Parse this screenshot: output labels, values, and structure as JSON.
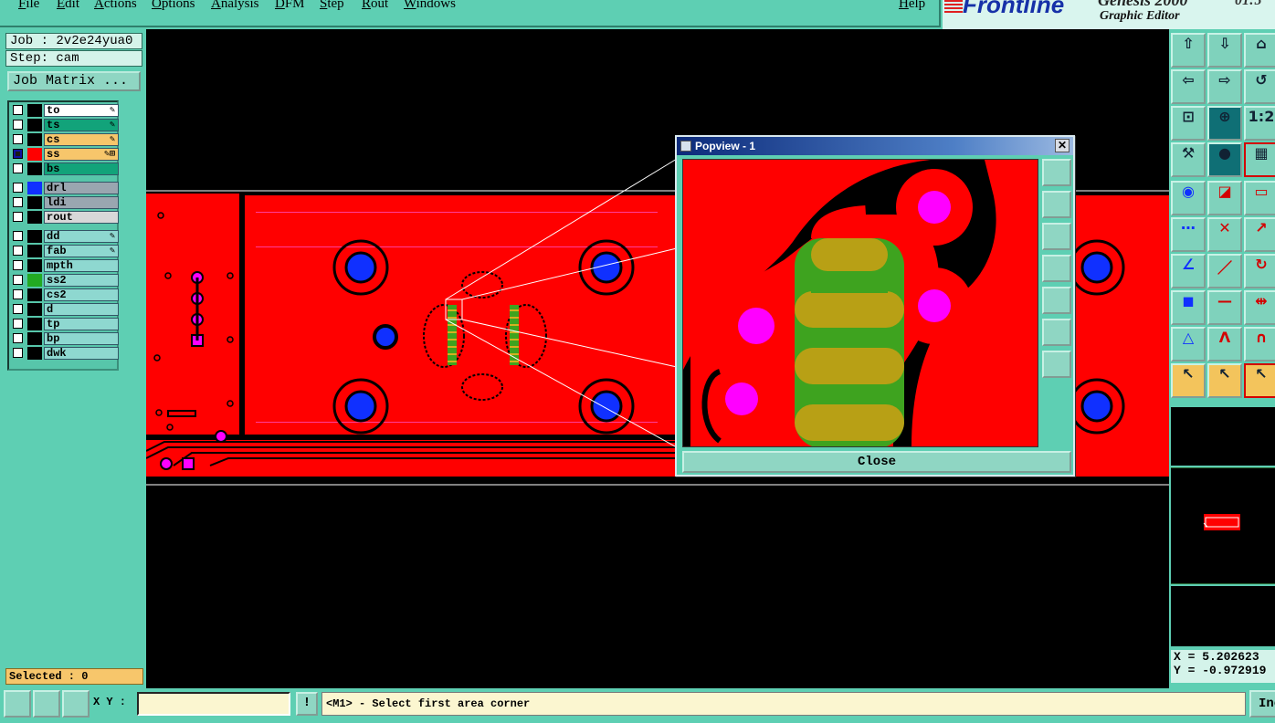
{
  "menu": {
    "items": [
      "File",
      "Edit",
      "Actions",
      "Options",
      "Analysis",
      "DFM",
      "Step",
      "Rout",
      "Windows"
    ],
    "help": "Help"
  },
  "brand": {
    "logo": "Frontline",
    "product": "Genesis 2000",
    "subtitle": "Graphic Editor",
    "clock": "01:5"
  },
  "job": {
    "job_label": "Job : 2v2e24yua0",
    "step_label": "Step: cam",
    "matrix_button": "Job Matrix ..."
  },
  "layers": [
    {
      "name": "to",
      "color": "#ffffff",
      "checked": false,
      "mark": "✎"
    },
    {
      "name": "ts",
      "color": "#12a37a",
      "checked": false,
      "mark": "✎"
    },
    {
      "name": "cs",
      "color": "#f7c66b",
      "checked": false,
      "mark": "✎"
    },
    {
      "name": "ss",
      "color": "#f7c66b",
      "swatch": "#ff0000",
      "checked": true,
      "mark": "✎⊞"
    },
    {
      "name": "bs",
      "color": "#12a37a",
      "checked": false,
      "mark": ""
    },
    {
      "name": "drl",
      "color": "#9aa6b0",
      "swatch": "#1030ff",
      "checked": false,
      "mark": ""
    },
    {
      "name": "ldi",
      "color": "#9aa6b0",
      "checked": false,
      "mark": ""
    },
    {
      "name": "rout",
      "color": "#d8d8d8",
      "checked": false,
      "mark": ""
    },
    {
      "name": "dd",
      "color": "#8ed8d0",
      "checked": false,
      "mark": "✎"
    },
    {
      "name": "fab",
      "color": "#8ed8d0",
      "checked": false,
      "mark": "✎"
    },
    {
      "name": "mpth",
      "color": "#8ed8d0",
      "checked": false,
      "mark": ""
    },
    {
      "name": "ss2",
      "color": "#8ed8d0",
      "swatch": "#22aa22",
      "checked": false,
      "mark": ""
    },
    {
      "name": "cs2",
      "color": "#8ed8d0",
      "checked": false,
      "mark": ""
    },
    {
      "name": "d",
      "color": "#8ed8d0",
      "checked": false,
      "mark": ""
    },
    {
      "name": "tp",
      "color": "#8ed8d0",
      "checked": false,
      "mark": ""
    },
    {
      "name": "bp",
      "color": "#8ed8d0",
      "checked": false,
      "mark": ""
    },
    {
      "name": "dwk",
      "color": "#8ed8d0",
      "checked": false,
      "mark": ""
    }
  ],
  "selected": "Selected : 0",
  "popview": {
    "title": "Popview - 1",
    "close_button": "Close",
    "close_x": "✕"
  },
  "coords": {
    "x": "X = 5.202623",
    "y": "Y = -0.972919"
  },
  "statusbar": {
    "xy_label": "X Y :",
    "xy_value": "",
    "exclaim": "!",
    "prompt": "<M1> - Select first area corner",
    "right_button": "Inc"
  },
  "toolbar_icons": [
    "view-top-icon",
    "view-bottom-icon",
    "home-icon",
    "pan-left-icon",
    "pan-right-icon",
    "undo-view-icon",
    "zoom-fit-icon",
    "zoom-center-icon",
    "scale-1-2-icon",
    "measure-icon",
    "net-icon",
    "layers-icon",
    "snap-pad-icon",
    "snap-edge-icon",
    "ruler-icon",
    "connect-icon",
    "cross-icon",
    "snap-point-icon",
    "line-angle-icon",
    "line-draw-icon",
    "arc-icon",
    "pad-edit-icon",
    "segment-icon",
    "distance-icon",
    "triangle-icon",
    "mountain-icon",
    "arch-icon",
    "pointer-icon",
    "select-icon",
    "select-alt-icon"
  ],
  "colors": {
    "panel": "#5ecfb3",
    "copper": "#ff0000",
    "pad": "#ff00ff",
    "drill": "#1030ff",
    "overlay": "#22aa22"
  }
}
